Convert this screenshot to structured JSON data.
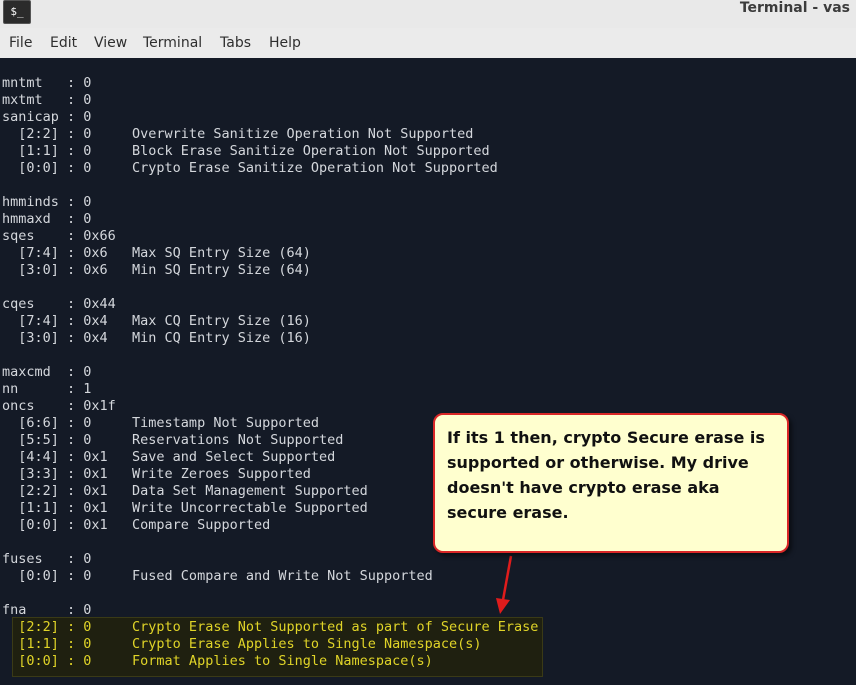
{
  "window": {
    "title": "Terminal - vas",
    "icon_glyph": "$_"
  },
  "menu": [
    "File",
    "Edit",
    "View",
    "Terminal",
    "Tabs",
    "Help"
  ],
  "terminal": {
    "lines": [
      "mntmt   : 0",
      "mxtmt   : 0",
      "sanicap : 0",
      "  [2:2] : 0     Overwrite Sanitize Operation Not Supported",
      "  [1:1] : 0     Block Erase Sanitize Operation Not Supported",
      "  [0:0] : 0     Crypto Erase Sanitize Operation Not Supported",
      "",
      "hmminds : 0",
      "hmmaxd  : 0",
      "sqes    : 0x66",
      "  [7:4] : 0x6   Max SQ Entry Size (64)",
      "  [3:0] : 0x6   Min SQ Entry Size (64)",
      "",
      "cqes    : 0x44",
      "  [7:4] : 0x4   Max CQ Entry Size (16)",
      "  [3:0] : 0x4   Min CQ Entry Size (16)",
      "",
      "maxcmd  : 0",
      "nn      : 1",
      "oncs    : 0x1f",
      "  [6:6] : 0     Timestamp Not Supported",
      "  [5:5] : 0     Reservations Not Supported",
      "  [4:4] : 0x1   Save and Select Supported",
      "  [3:3] : 0x1   Write Zeroes Supported",
      "  [2:2] : 0x1   Data Set Management Supported",
      "  [1:1] : 0x1   Write Uncorrectable Supported",
      "  [0:0] : 0x1   Compare Supported",
      "",
      "fuses   : 0",
      "  [0:0] : 0     Fused Compare and Write Not Supported",
      "",
      "fna     : 0"
    ],
    "highlighted_lines": [
      "  [2:2] : 0     Crypto Erase Not Supported as part of Secure Erase",
      "  [1:1] : 0     Crypto Erase Applies to Single Namespace(s)",
      "  [0:0] : 0     Format Applies to Single Namespace(s)"
    ]
  },
  "callout": {
    "text": "If its 1 then, crypto Secure erase is supported or otherwise. My drive doesn't have crypto erase aka secure erase."
  },
  "colors": {
    "terminal_bg": "#141a26",
    "terminal_fg": "#d4d7dc",
    "highlight_fg": "#e0d428",
    "callout_bg": "#ffffcf",
    "callout_border": "#d92727"
  }
}
